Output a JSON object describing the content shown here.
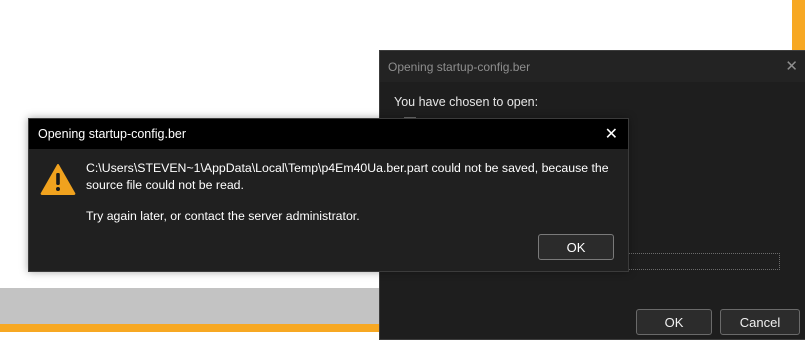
{
  "colors": {
    "accent_orange": "#f7a823",
    "warning_yellow": "#f0a21e",
    "dialog_bg": "#202020"
  },
  "back_dialog": {
    "title": "Opening startup-config.ber",
    "close_glyph": "✕",
    "prompt": "You have chosen to open:",
    "ok_label": "OK",
    "cancel_label": "Cancel"
  },
  "error_dialog": {
    "title": "Opening startup-config.ber",
    "close_glyph": "✕",
    "icon": "warning-icon",
    "message_line1": "C:\\Users\\STEVEN~1\\AppData\\Local\\Temp\\p4Em40Ua.ber.part could not be saved, because the",
    "message_line2": "source file could not be read.",
    "message_line3": "Try again later, or contact the server administrator.",
    "ok_label": "OK"
  }
}
